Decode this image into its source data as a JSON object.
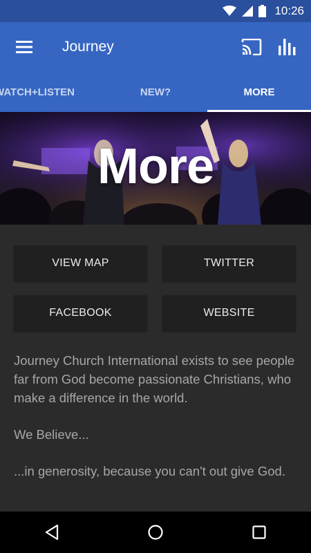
{
  "status_bar": {
    "time": "10:26",
    "icons": [
      "wifi-icon",
      "signal-icon",
      "battery-icon"
    ]
  },
  "app_bar": {
    "title": "Journey",
    "icons": [
      "hamburger-menu-icon",
      "cast-icon",
      "bar-chart-icon"
    ]
  },
  "tabs": [
    {
      "label": "WATCH+LISTEN",
      "active": false
    },
    {
      "label": "NEW?",
      "active": false
    },
    {
      "label": "MORE",
      "active": true
    }
  ],
  "hero": {
    "title": "More"
  },
  "buttons": {
    "view_map": "VIEW MAP",
    "twitter": "TWITTER",
    "facebook": "FACEBOOK",
    "website": "WEBSITE"
  },
  "body_text": {
    "mission": "Journey Church International exists to see people far from God become passionate Christians, who make a difference in the world.",
    "we_believe": "We Believe...",
    "generosity": "...in generosity, because you can't out give God."
  },
  "nav_bar": {
    "icons": [
      "back-icon",
      "home-icon",
      "recents-icon"
    ]
  },
  "colors": {
    "app_bar": "#3666c2",
    "status_bar": "#2a4f9c",
    "background": "#2b2b2c",
    "button": "#202021",
    "body_text": "#a7a7a9"
  }
}
